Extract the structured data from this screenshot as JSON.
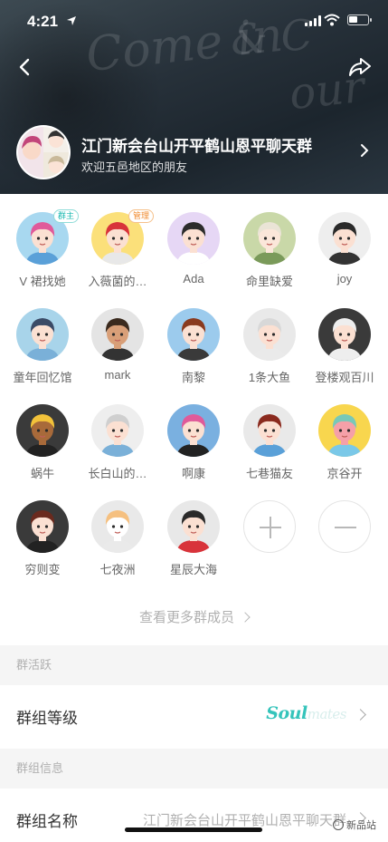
{
  "status_bar": {
    "time": "4:21"
  },
  "header": {
    "group_name": "江门新会台山开平鹤山恩平聊天群",
    "subtitle": "欢迎五邑地区的朋友"
  },
  "badges": {
    "owner": "群主",
    "admin": "管理"
  },
  "members": [
    {
      "name": "V 裙找她",
      "badge": "owner"
    },
    {
      "name": "入薇菌的…",
      "badge": "admin"
    },
    {
      "name": "Ada"
    },
    {
      "name": "命里缺爱"
    },
    {
      "name": "joy"
    },
    {
      "name": "童年回忆馆"
    },
    {
      "name": "mark"
    },
    {
      "name": "南黎"
    },
    {
      "name": "1条大鱼"
    },
    {
      "name": "登楼观百川"
    },
    {
      "name": "蜗牛"
    },
    {
      "name": "长白山的…"
    },
    {
      "name": "啊康"
    },
    {
      "name": "七巷猫友"
    },
    {
      "name": "京谷开"
    },
    {
      "name": "穷则变"
    },
    {
      "name": "七夜洲"
    },
    {
      "name": "星辰大海"
    }
  ],
  "more_members": "查看更多群成员",
  "sections": {
    "activity": {
      "title": "群活跃",
      "level_label": "群组等级",
      "logo_text": "Soul",
      "logo_suffix": "mates"
    },
    "info": {
      "title": "群组信息",
      "name_label": "群组名称",
      "name_value": "江门新会台山开平鹤山恩平聊天群"
    }
  },
  "watermark": "新品站"
}
